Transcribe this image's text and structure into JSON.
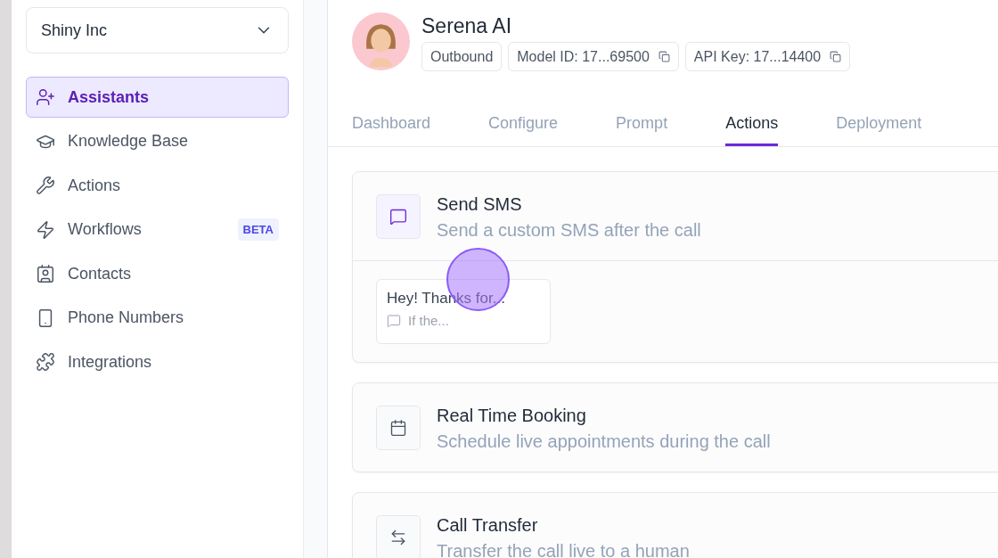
{
  "workspace_select": {
    "value": "Shiny Inc"
  },
  "sidebar": {
    "items": [
      {
        "label": "Assistants",
        "kind": "assistants",
        "selected": true
      },
      {
        "label": "Knowledge Base",
        "kind": "knowledge",
        "selected": false
      },
      {
        "label": "Actions",
        "kind": "actions",
        "selected": false
      },
      {
        "label": "Workflows",
        "kind": "workflows",
        "selected": false,
        "badge": "BETA"
      },
      {
        "label": "Contacts",
        "kind": "contacts",
        "selected": false
      },
      {
        "label": "Phone Numbers",
        "kind": "numbers",
        "selected": false
      },
      {
        "label": "Integrations",
        "kind": "integrations",
        "selected": false
      }
    ]
  },
  "assistant": {
    "name": "Serena AI",
    "tags": [
      {
        "label": "Outbound",
        "copyable": false
      },
      {
        "label": "Model ID: 17...69500",
        "copyable": true
      },
      {
        "label": "API Key: 17...14400",
        "copyable": true
      }
    ]
  },
  "tabs": [
    {
      "label": "Dashboard",
      "selected": false
    },
    {
      "label": "Configure",
      "selected": false
    },
    {
      "label": "Prompt",
      "selected": false
    },
    {
      "label": "Actions",
      "selected": true
    },
    {
      "label": "Deployment",
      "selected": false
    }
  ],
  "actions": [
    {
      "title": "Send SMS",
      "description": "Send a custom SMS after the call",
      "kind": "sms",
      "active": true,
      "messages": [
        {
          "text": "Hey! Thanks for...",
          "condition": "If the..."
        }
      ]
    },
    {
      "title": "Real Time Booking",
      "description": "Schedule live appointments during the call",
      "kind": "booking",
      "active": false
    },
    {
      "title": "Call Transfer",
      "description": "Transfer the call live to a human",
      "kind": "transfer",
      "active": false
    }
  ],
  "click_indicator": {
    "visible": true
  }
}
